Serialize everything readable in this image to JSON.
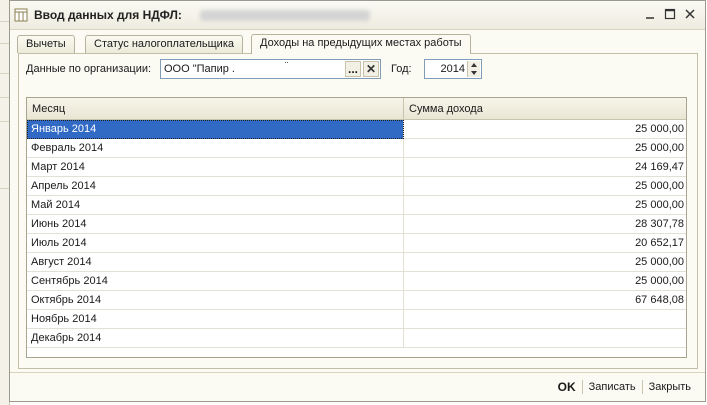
{
  "window": {
    "title": "Ввод данных для НДФЛ:",
    "controls": {
      "minimize": "_",
      "maximize": "☐",
      "close": "✕"
    }
  },
  "tabs": [
    {
      "label": "Вычеты",
      "active": false
    },
    {
      "label": "Статус налогоплательщика",
      "active": false
    },
    {
      "label": "Доходы на предыдущих местах работы",
      "active": true
    }
  ],
  "filters": {
    "org_label": "Данные по организации:",
    "org_value": "ООО \"Папир .",
    "org_dots": "¨",
    "select_button": "...",
    "clear_button": "✕",
    "year_label": "Год:",
    "year_value": "2014"
  },
  "table": {
    "columns": {
      "month": "Месяц",
      "amount": "Сумма дохода"
    },
    "rows": [
      {
        "month": "Январь 2014",
        "amount": "25 000,00"
      },
      {
        "month": "Февраль 2014",
        "amount": "25 000,00"
      },
      {
        "month": "Март 2014",
        "amount": "24 169,47"
      },
      {
        "month": "Апрель 2014",
        "amount": "25 000,00"
      },
      {
        "month": "Май 2014",
        "amount": "25 000,00"
      },
      {
        "month": "Июнь 2014",
        "amount": "28 307,78"
      },
      {
        "month": "Июль 2014",
        "amount": "20 652,17"
      },
      {
        "month": "Август 2014",
        "amount": "25 000,00"
      },
      {
        "month": "Сентябрь 2014",
        "amount": "25 000,00"
      },
      {
        "month": "Октябрь 2014",
        "amount": "67 648,08"
      },
      {
        "month": "Ноябрь 2014",
        "amount": ""
      },
      {
        "month": "Декабрь 2014",
        "amount": ""
      }
    ],
    "selected_row": 0
  },
  "footer": {
    "ok": "OK",
    "save": "Записать",
    "close": "Закрыть"
  },
  "colors": {
    "selection": "#316ac5",
    "border": "#a9a48d",
    "window_bg": "#fbfaf3"
  }
}
